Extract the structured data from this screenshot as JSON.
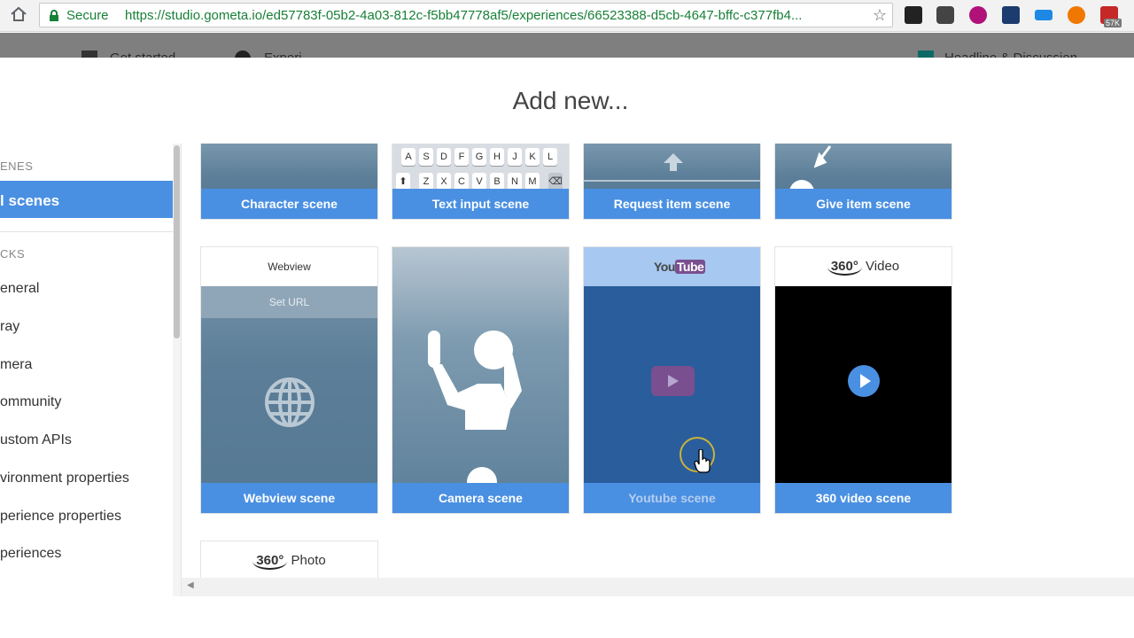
{
  "browser": {
    "secure_label": "Secure",
    "url": "https://studio.gometa.io/ed57783f-05b2-4a03-812c-f5bb47778af5/experiences/66523388-d5cb-4647-bffc-c377fb4...",
    "ext_badge": "57K",
    "ext_colors": [
      "#333333",
      "#555555",
      "#b0127a",
      "#1c3b6e",
      "#1e88e5",
      "#f07800",
      "#c62828"
    ]
  },
  "appbar": {
    "items": [
      "Get started",
      "Experi...",
      "Headline & Discussion"
    ]
  },
  "modal": {
    "title": "Add new..."
  },
  "sidebar": {
    "section1": "ENES",
    "active": "l scenes",
    "section2": "CKS",
    "items": [
      "eneral",
      "ray",
      "mera",
      "ommunity",
      "ustom APIs",
      "vironment properties",
      "perience properties",
      "periences"
    ]
  },
  "cards": {
    "row1": [
      "Character scene",
      "Text input scene",
      "Request item scene",
      "Give item scene"
    ],
    "row2": [
      "Webview scene",
      "Camera scene",
      "Youtube scene",
      "360 video scene"
    ],
    "keyboard_row1": [
      "A",
      "S",
      "D",
      "F",
      "G",
      "H",
      "J",
      "K",
      "L"
    ],
    "keyboard_row2": [
      "Z",
      "X",
      "C",
      "V",
      "B",
      "N",
      "M"
    ],
    "webview_header": "Webview",
    "webview_url": "Set URL",
    "youtube_logo_you": "You",
    "youtube_logo_tube": "Tube",
    "video360_badge": "360°",
    "video360_label": "Video",
    "photo360_badge": "360°",
    "photo360_label": "Photo"
  },
  "colors": {
    "accent": "#4a90e2",
    "youtube_blue": "#2a5d9c",
    "youtube_header": "#a7c8f1",
    "youtube_play": "#7a4f8f"
  }
}
